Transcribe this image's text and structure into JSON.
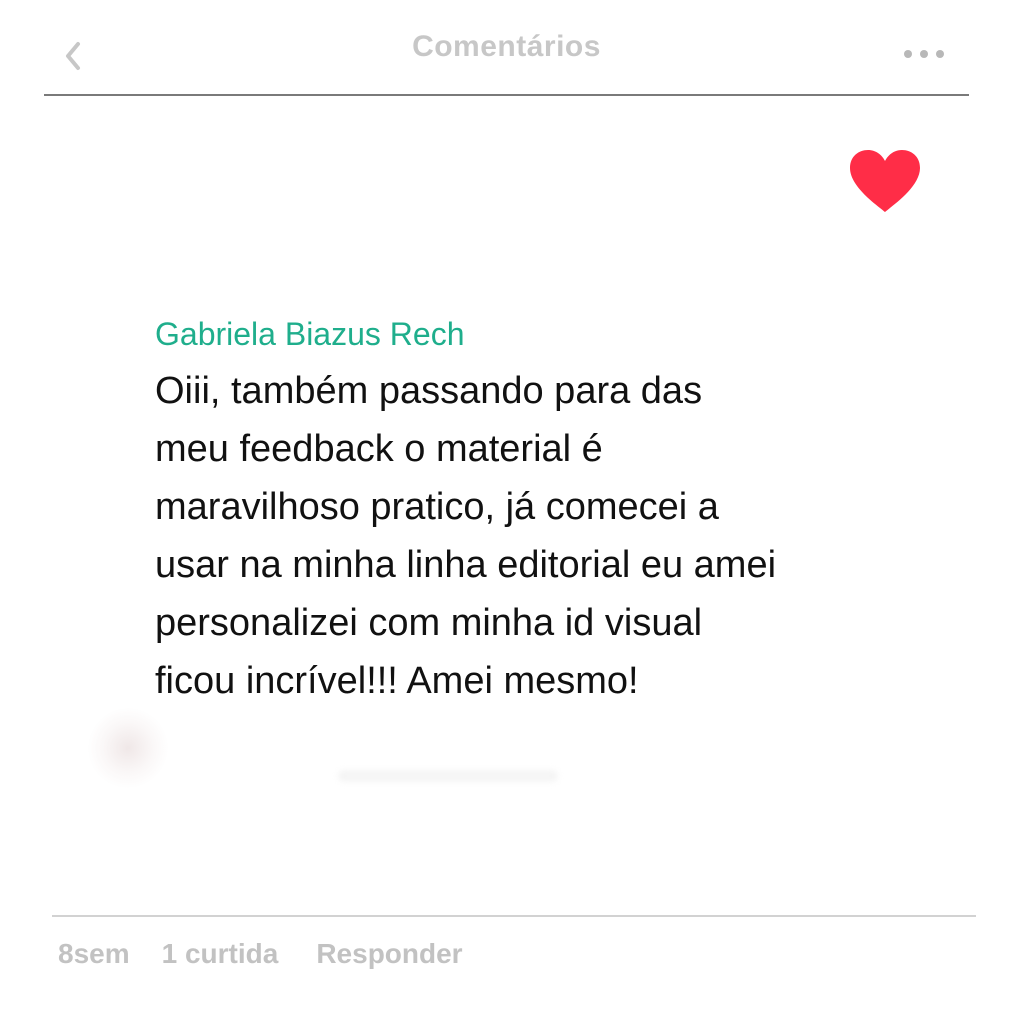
{
  "header": {
    "title": "Comentários",
    "back_icon": "chevron-left-icon",
    "more_icon": "more-horizontal-icon"
  },
  "comment": {
    "author": "Gabriela Biazus Rech",
    "text": "Oiii, também passando para das\nmeu feedback o material é\nmaravilhoso pratico, já comecei a\nusar na minha linha editorial eu amei\npersonalizei com minha id visual\nficou incrível!!! Amei mesmo!",
    "liked": true,
    "like_icon": "heart-icon"
  },
  "footer": {
    "time": "8sem",
    "likes": "1 curtida",
    "reply": "Responder"
  },
  "colors": {
    "author": "#1fae8c",
    "heart": "#ff2d47",
    "muted": "#c2c2c2",
    "text": "#111111"
  }
}
